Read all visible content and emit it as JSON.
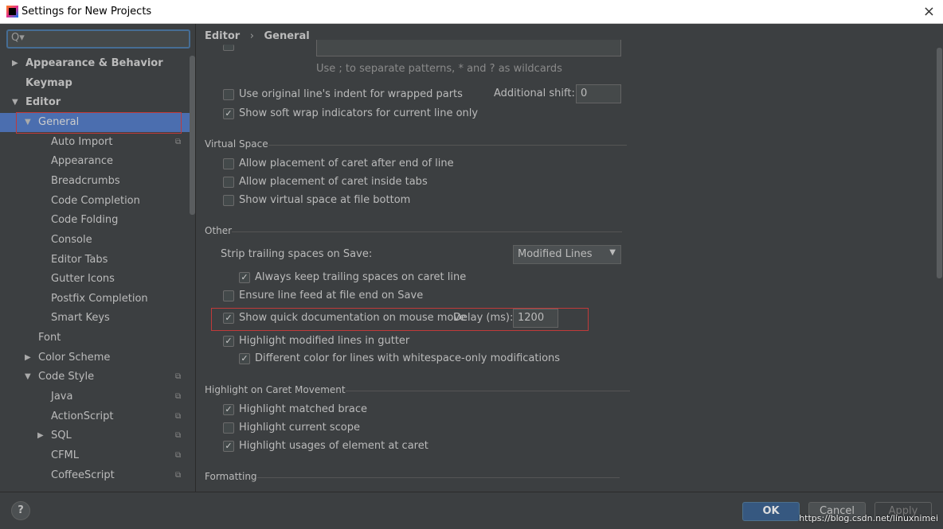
{
  "window": {
    "title": "Settings for New Projects",
    "close_icon": "×"
  },
  "search": {
    "placeholder": "",
    "icon": "Q▾"
  },
  "sidebar": {
    "items": [
      {
        "label": "Appearance & Behavior",
        "level": 0,
        "arrow": "▶",
        "bold": true
      },
      {
        "label": "Keymap",
        "level": 0,
        "arrow": "",
        "bold": true
      },
      {
        "label": "Editor",
        "level": 0,
        "arrow": "▼",
        "bold": true
      },
      {
        "label": "General",
        "level": 1,
        "arrow": "▼",
        "selected": true
      },
      {
        "label": "Auto Import",
        "level": 2,
        "copy": true
      },
      {
        "label": "Appearance",
        "level": 2
      },
      {
        "label": "Breadcrumbs",
        "level": 2
      },
      {
        "label": "Code Completion",
        "level": 2
      },
      {
        "label": "Code Folding",
        "level": 2
      },
      {
        "label": "Console",
        "level": 2
      },
      {
        "label": "Editor Tabs",
        "level": 2
      },
      {
        "label": "Gutter Icons",
        "level": 2
      },
      {
        "label": "Postfix Completion",
        "level": 2
      },
      {
        "label": "Smart Keys",
        "level": 2
      },
      {
        "label": "Font",
        "level": 1
      },
      {
        "label": "Color Scheme",
        "level": 1,
        "arrow": "▶"
      },
      {
        "label": "Code Style",
        "level": 1,
        "arrow": "▼",
        "copy": true
      },
      {
        "label": "Java",
        "level": 2,
        "copy": true
      },
      {
        "label": "ActionScript",
        "level": 2,
        "copy": true
      },
      {
        "label": "SQL",
        "level": 2,
        "arrow": "▶",
        "copy": true
      },
      {
        "label": "CFML",
        "level": 2,
        "copy": true
      },
      {
        "label": "CoffeeScript",
        "level": 2,
        "copy": true
      }
    ]
  },
  "breadcrumb": {
    "parent": "Editor",
    "sep": "›",
    "current": "General"
  },
  "main": {
    "soft_wrap_hint": "Use ; to separate patterns, * and ? as wildcards",
    "use_original_indent": {
      "label": "Use original line's indent for wrapped parts",
      "checked": false
    },
    "additional_shift": {
      "label": "Additional shift:",
      "value": "0"
    },
    "show_soft_wrap_indicators": {
      "label": "Show soft wrap indicators for current line only",
      "checked": true
    },
    "virtual_space": {
      "title": "Virtual Space",
      "items": [
        {
          "label": "Allow placement of caret after end of line",
          "checked": false
        },
        {
          "label": "Allow placement of caret inside tabs",
          "checked": false
        },
        {
          "label": "Show virtual space at file bottom",
          "checked": false
        }
      ]
    },
    "other": {
      "title": "Other",
      "strip_label": "Strip trailing spaces on Save:",
      "strip_value": "Modified Lines",
      "keep_trailing": {
        "label": "Always keep trailing spaces on caret line",
        "checked": true
      },
      "ensure_lf": {
        "label": "Ensure line feed at file end on Save",
        "checked": false
      },
      "quick_doc": {
        "label": "Show quick documentation on mouse move",
        "checked": true
      },
      "delay_label": "Delay (ms):",
      "delay_value": "1200",
      "highlight_modified": {
        "label": "Highlight modified lines in gutter",
        "checked": true
      },
      "different_color": {
        "label": "Different color for lines with whitespace-only modifications",
        "checked": true
      }
    },
    "caret": {
      "title": "Highlight on Caret Movement",
      "items": [
        {
          "label": "Highlight matched brace",
          "checked": true
        },
        {
          "label": "Highlight current scope",
          "checked": false
        },
        {
          "label": "Highlight usages of element at caret",
          "checked": true
        }
      ]
    },
    "formatting": {
      "title": "Formatting"
    }
  },
  "footer": {
    "help": "?",
    "ok": "OK",
    "cancel": "Cancel",
    "apply": "Apply",
    "watermark": "https://blog.csdn.net/linuxnimei"
  },
  "colors": {
    "selection": "#4b6eaf",
    "ok_button": "#365880",
    "highlight_box": "#c03a3a"
  }
}
